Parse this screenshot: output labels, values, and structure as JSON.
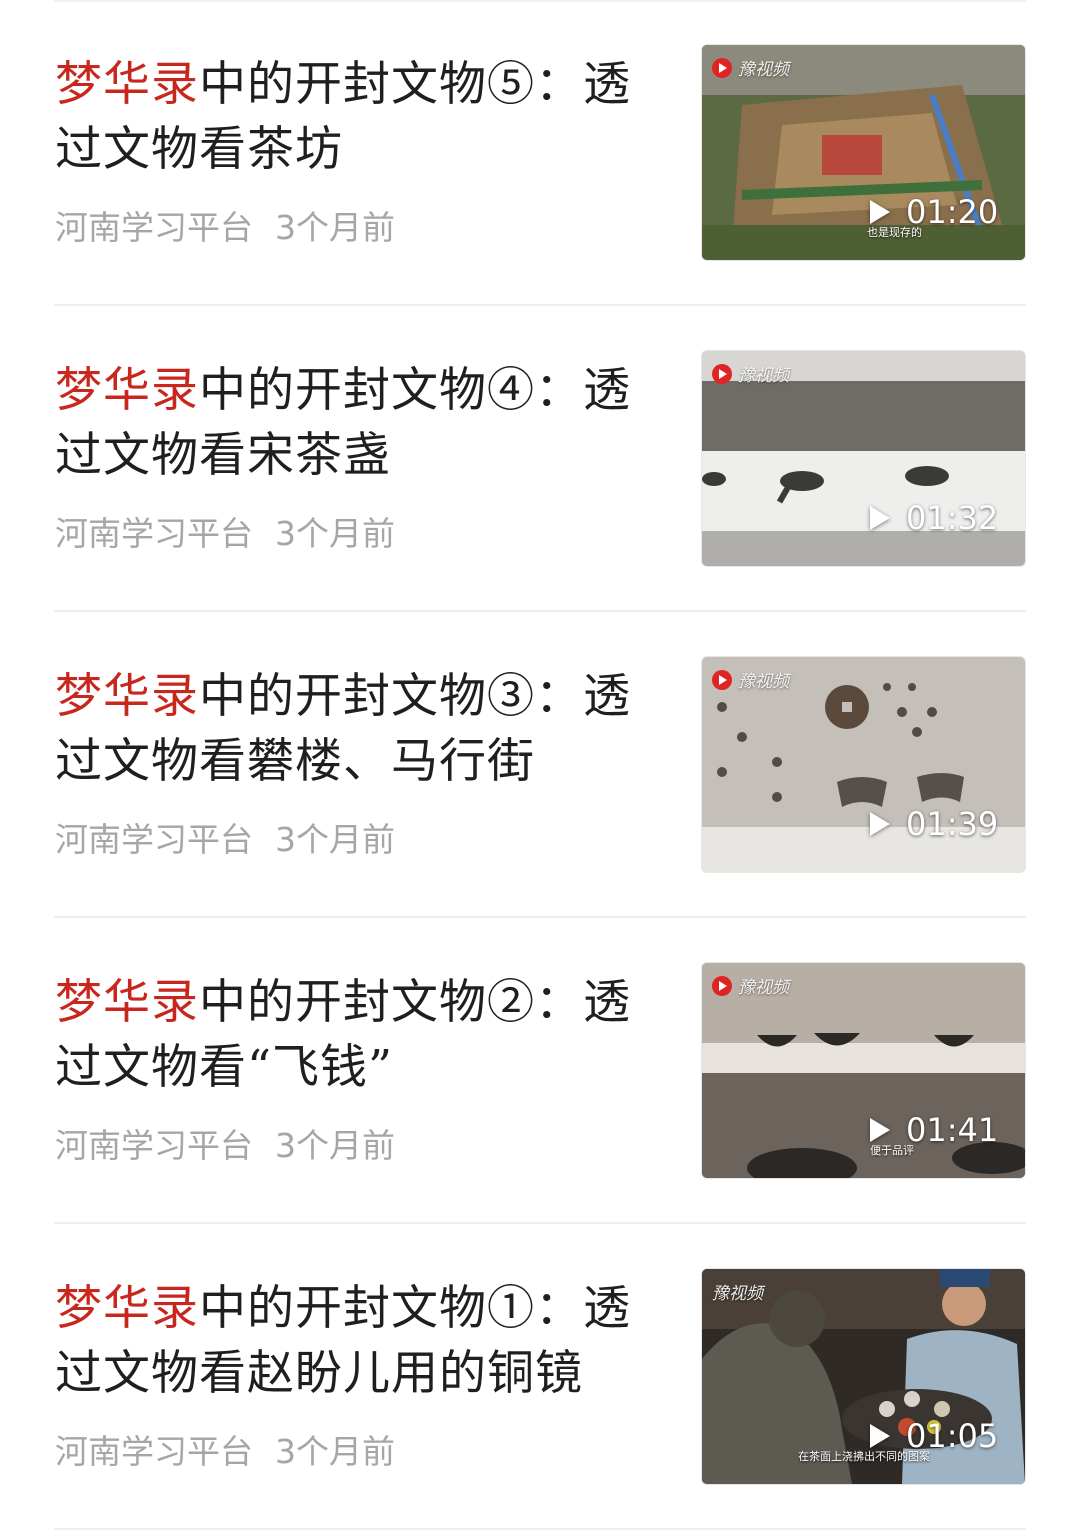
{
  "articles": [
    {
      "title_highlight": "梦华录",
      "title_rest": "中的开封文物⑤：透过文物看茶坊",
      "source": "河南学习平台",
      "time": "3个月前",
      "duration": "01:20",
      "watermark": "豫视频",
      "subtitle": "也是现存的"
    },
    {
      "title_highlight": "梦华录",
      "title_rest": "中的开封文物④：透过文物看宋茶盏",
      "source": "河南学习平台",
      "time": "3个月前",
      "duration": "01:32",
      "watermark": "豫视频",
      "subtitle": ""
    },
    {
      "title_highlight": "梦华录",
      "title_rest": "中的开封文物③：透过文物看礬楼、马行街",
      "source": "河南学习平台",
      "time": "3个月前",
      "duration": "01:39",
      "watermark": "豫视频",
      "subtitle": ""
    },
    {
      "title_highlight": "梦华录",
      "title_rest": "中的开封文物②：透过文物看“飞钱”",
      "source": "河南学习平台",
      "time": "3个月前",
      "duration": "01:41",
      "watermark": "豫视频",
      "subtitle": "便于品评"
    },
    {
      "title_highlight": "梦华录",
      "title_rest": "中的开封文物①：透过文物看赵盼儿用的铜镜",
      "source": "河南学习平台",
      "time": "3个月前",
      "duration": "01:05",
      "watermark": "豫视频",
      "subtitle": "在茶面上浇拂出不同的图案"
    }
  ]
}
